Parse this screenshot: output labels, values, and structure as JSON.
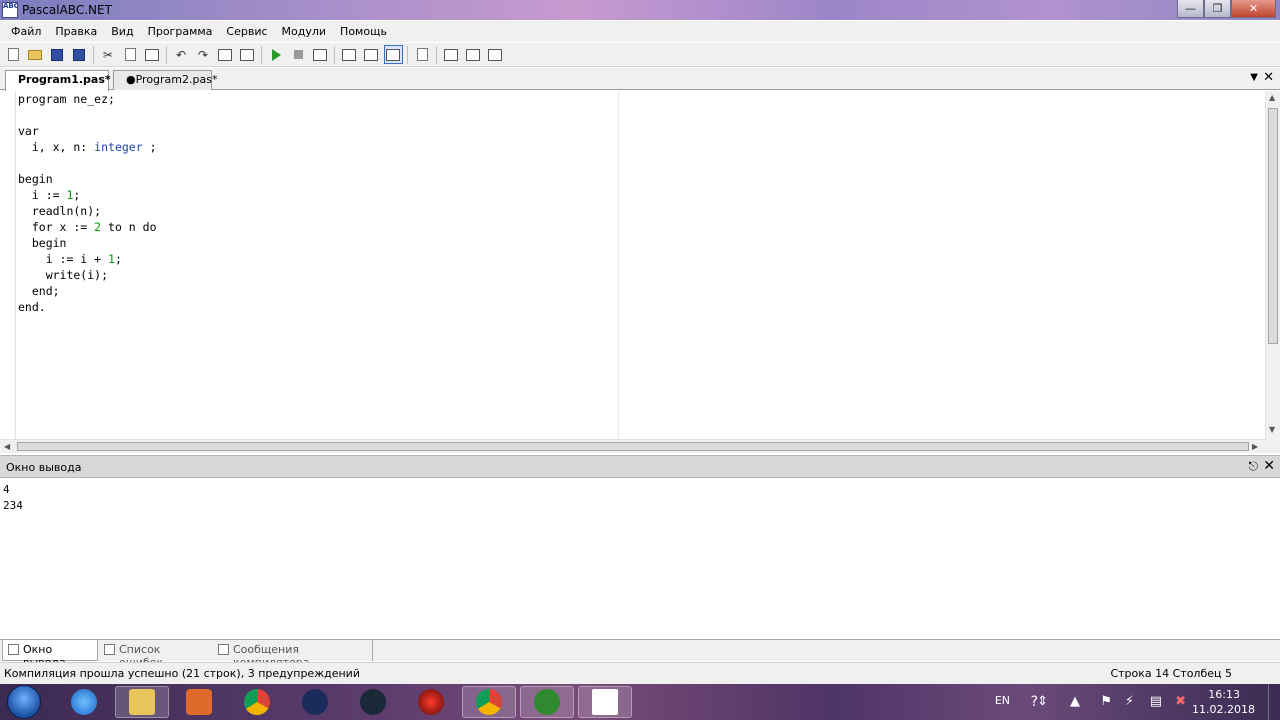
{
  "window": {
    "title": "PascalABC.NET",
    "icon_text": "AB C .net"
  },
  "menu": [
    "Файл",
    "Правка",
    "Вид",
    "Программа",
    "Сервис",
    "Модули",
    "Помощь"
  ],
  "tabs": [
    {
      "label": "Program1.pas*"
    },
    {
      "label": "●Program2.pas*"
    }
  ],
  "editor": {
    "lines": [
      [
        {
          "t": "program ne_ez;",
          "c": "plain"
        }
      ],
      [
        {
          "t": "",
          "c": "plain"
        }
      ],
      [
        {
          "t": "var",
          "c": "plain"
        }
      ],
      [
        {
          "t": "  i, x, n: ",
          "c": "plain"
        },
        {
          "t": "integer",
          "c": "kw"
        },
        {
          "t": " ;",
          "c": "plain"
        }
      ],
      [
        {
          "t": "",
          "c": "plain"
        }
      ],
      [
        {
          "t": "begin",
          "c": "plain"
        }
      ],
      [
        {
          "t": "  i := ",
          "c": "plain"
        },
        {
          "t": "1",
          "c": "num"
        },
        {
          "t": ";",
          "c": "plain"
        }
      ],
      [
        {
          "t": "  readln(n);",
          "c": "plain"
        }
      ],
      [
        {
          "t": "  for x := ",
          "c": "plain"
        },
        {
          "t": "2",
          "c": "num"
        },
        {
          "t": " to n do",
          "c": "plain"
        }
      ],
      [
        {
          "t": "  begin",
          "c": "plain"
        }
      ],
      [
        {
          "t": "    i := i + ",
          "c": "plain"
        },
        {
          "t": "1",
          "c": "num"
        },
        {
          "t": ";",
          "c": "plain"
        }
      ],
      [
        {
          "t": "    write(i);",
          "c": "plain"
        }
      ],
      [
        {
          "t": "  end;",
          "c": "plain"
        }
      ],
      [
        {
          "t": "end.",
          "c": "plain"
        }
      ]
    ]
  },
  "output_pane": {
    "title": "Окно вывода",
    "lines": [
      "4",
      "234"
    ]
  },
  "bottom_tabs": [
    "Окно вывода",
    "Список ошибок",
    "Сообщения компилятора"
  ],
  "status": {
    "message": "Компиляция прошла успешно (21 строк), 3 предупреждений",
    "position": "Строка  14   Столбец  5"
  },
  "taskbar": {
    "lang": "EN",
    "time": "16:13",
    "date": "11.02.2018"
  },
  "colors": {
    "keyword": "#1c3fb8",
    "number": "#00a000"
  }
}
